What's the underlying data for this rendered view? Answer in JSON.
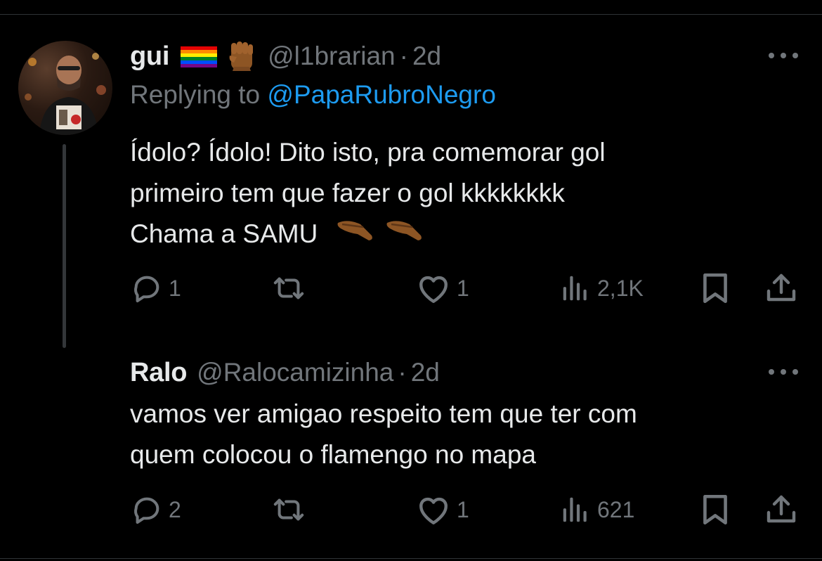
{
  "tweets": [
    {
      "name": "gui",
      "handle": "@l1brarian",
      "separator": "·",
      "time": "2d",
      "replying_prefix": "Replying to ",
      "replying_to": "@PapaRubroNegro",
      "text_lines": [
        "Ídolo? Ídolo! Dito isto, pra comemorar gol",
        "primeiro tem que fazer o gol kkkkkkkk",
        "Chama a SAMU"
      ],
      "stats": {
        "replies": "1",
        "likes": "1",
        "views": "2,1K"
      }
    },
    {
      "name": "Ralo",
      "handle": "@Ralocamizinha",
      "separator": "·",
      "time": "2d",
      "text_lines": [
        "vamos ver amigao respeito tem que ter com",
        "quem colocou o flamengo no mapa"
      ],
      "stats": {
        "replies": "2",
        "likes": "1",
        "views": "621"
      }
    }
  ],
  "icons": {
    "reply": "speech-bubble-icon",
    "retweet": "retweet-icon",
    "like": "heart-icon",
    "views": "bar-chart-icon",
    "bookmark": "bookmark-icon",
    "share": "share-upload-icon",
    "more": "more-dots-icon",
    "badges": [
      "rainbow-flag-icon",
      "raised-fist-icon"
    ],
    "trailing_emoji": [
      "pinching-hand-icon",
      "pinching-hand-icon"
    ]
  },
  "colors": {
    "background": "#000000",
    "text": "#e7e9ea",
    "muted": "#71767b",
    "link": "#1d9bf0",
    "divider": "#2f3336"
  }
}
